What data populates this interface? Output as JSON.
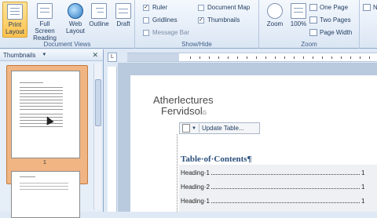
{
  "ribbon": {
    "document_views": {
      "label": "Document Views",
      "buttons": [
        {
          "label": "Print Layout",
          "active": true
        },
        {
          "label": "Full Screen Reading"
        },
        {
          "label": "Web Layout"
        },
        {
          "label": "Outline"
        },
        {
          "label": "Draft"
        }
      ]
    },
    "show_hide": {
      "label": "Show/Hide",
      "items": [
        {
          "label": "Ruler",
          "checked": true
        },
        {
          "label": "Document Map",
          "checked": false
        },
        {
          "label": "Gridlines",
          "checked": false
        },
        {
          "label": "Thumbnails",
          "checked": true
        },
        {
          "label": "Message Bar",
          "checked": false,
          "disabled": true
        }
      ]
    },
    "zoom": {
      "label": "Zoom",
      "zoom_label": "Zoom",
      "percent_label": "100%",
      "one_page": "One Page",
      "two_pages": "Two Pages",
      "page_width": "Page Width"
    },
    "edge": {
      "n_label": "N"
    }
  },
  "pane": {
    "title": "Thumbnails",
    "page_number": "1"
  },
  "ruler": {
    "corner": "L"
  },
  "document": {
    "title": "Atherlectures",
    "subtitle": "Fervidsol",
    "subtitle_mark": "G",
    "toc_update": "Update Table...",
    "toc_heading": "Table·of·Contents¶",
    "toc_rows": [
      {
        "text": "Heading·1",
        "page": "1"
      },
      {
        "text": "Heading·2",
        "page": "1"
      },
      {
        "text": "Heading·1",
        "page": "1"
      }
    ]
  },
  "colors": {
    "accent": "#ffc24d",
    "ribbon": "#dbe6f4",
    "toc_heading": "#2a4f7c"
  }
}
